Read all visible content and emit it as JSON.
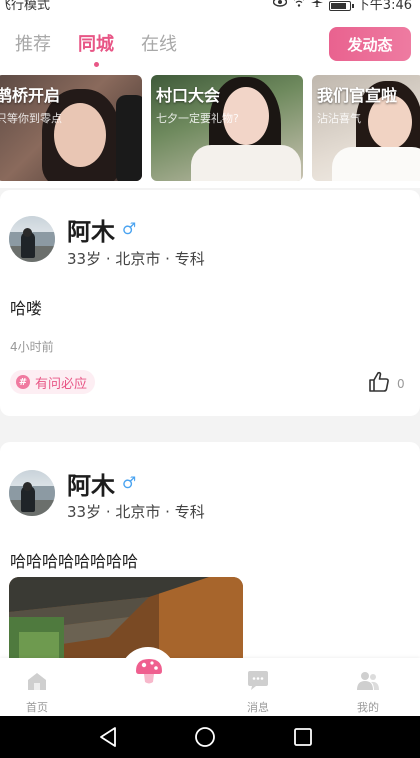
{
  "status_bar": {
    "left_text": "飞行模式",
    "time": "下午3:46"
  },
  "header": {
    "tabs": [
      {
        "label": "推荐",
        "active": false
      },
      {
        "label": "同城",
        "active": true
      },
      {
        "label": "在线",
        "active": false
      }
    ],
    "publish_label": "发动态"
  },
  "banners": [
    {
      "title": "鹊桥开启",
      "subtitle": "只等你到零点"
    },
    {
      "title": "村口大会",
      "subtitle": "七夕一定要礼物?"
    },
    {
      "title": "我们官宣啦",
      "subtitle": "沾沾喜气"
    }
  ],
  "posts": [
    {
      "username": "阿木",
      "gender_icon": "male-icon",
      "meta": "33岁 · 北京市 · 专科",
      "text": "哈喽",
      "time": "4小时前",
      "topic": "有问必应",
      "like_count": "0"
    },
    {
      "username": "阿木",
      "gender_icon": "male-icon",
      "meta": "33岁 · 北京市 · 专科",
      "text": "哈哈哈哈哈哈哈哈"
    }
  ],
  "bottom_nav": {
    "items": [
      {
        "label": "首页",
        "icon": "home-icon"
      },
      {
        "label": "",
        "icon": "mushroom-icon"
      },
      {
        "label": "消息",
        "icon": "message-icon"
      },
      {
        "label": "我的",
        "icon": "profile-icon"
      }
    ]
  },
  "colors": {
    "accent": "#e85686",
    "button_gradient_start": "#e9628f",
    "button_gradient_end": "#ee7ba1"
  }
}
